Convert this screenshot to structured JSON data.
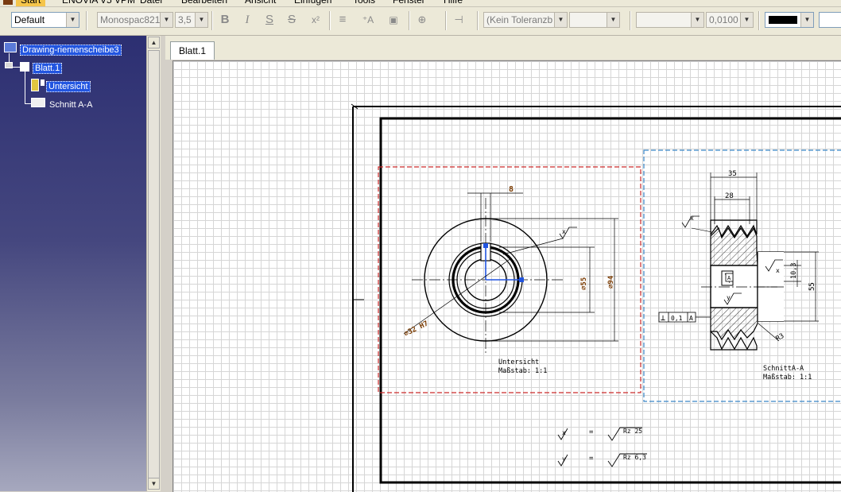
{
  "menu": {
    "items": [
      "Start",
      "ENOVIA V5 VPM",
      "Datei",
      "Bearbeiten",
      "Ansicht",
      "Einfügen",
      "Tools",
      "Fenster",
      "Hilfe"
    ]
  },
  "toolbar": {
    "style_value": "Default",
    "font_value": "Monospac821",
    "size_value": "3,5",
    "bold": "B",
    "italic": "I",
    "underline": "S",
    "strike": "S",
    "superscript": "x²",
    "tolerance_value": "(Kein Toleranzb",
    "precision_value": "0,0100"
  },
  "tree": {
    "root": "Drawing-riemenscheibe3",
    "sheet": "Blatt.1",
    "view1": "Untersicht",
    "view2": "Schnitt A-A"
  },
  "tabs": {
    "active": "Blatt.1"
  },
  "drawing": {
    "dim_8": "8",
    "dim_55": "⌀55",
    "dim_94": "⌀94",
    "dim_32": "⌀32 H7",
    "front_view_name": "Untersicht",
    "front_view_scale": "Maßstab:  1:1",
    "dim_35": "35",
    "dim_28": "28",
    "dim_10_3": "10,3",
    "dim_55_side": "55",
    "dim_r3": "R3",
    "tol_symbol": "⊥",
    "tol_value": "0,1",
    "tol_ref": "A",
    "datum": "A",
    "section_view_name": "SchnittA-A",
    "section_view_scale": "Maßstab:  1:1",
    "rough_x": "x",
    "rough_y": "y",
    "eq": "=",
    "rz25": "Rz 25",
    "rz63": "Rz 6,3"
  },
  "colors": {
    "accent_blue": "#2255e0",
    "view_frame_red": "#cc2a2a",
    "view_frame_blue": "#3a86c8",
    "dim_text": "#7a3a00"
  }
}
